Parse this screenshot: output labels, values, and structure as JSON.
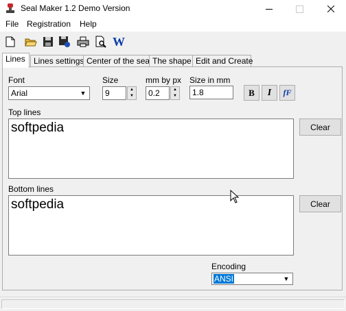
{
  "window": {
    "title": "Seal Maker 1.2 Demo Version",
    "icons": {
      "app": "stamp-icon",
      "minimize": "minimize-icon",
      "maximize": "maximize-icon",
      "close": "close-icon"
    }
  },
  "menu": {
    "file": "File",
    "registration": "Registration",
    "help": "Help"
  },
  "toolbar": {
    "icons": [
      "new-file-icon",
      "open-folder-icon",
      "save-icon",
      "save-as-icon",
      "print-icon",
      "print-preview-icon",
      "word-export-icon"
    ],
    "word_label": "W"
  },
  "tabs": [
    "Lines",
    "Lines settings",
    "Center of the seal",
    "The shape",
    "Edit and Create"
  ],
  "active_tab": "Lines",
  "font": {
    "label": "Font",
    "value": "Arial"
  },
  "size": {
    "label": "Size",
    "value": "9"
  },
  "mm_by_px": {
    "label": "mm by px",
    "value": "0.2"
  },
  "size_mm": {
    "label": "Size in mm",
    "value": "1.8"
  },
  "style_buttons": {
    "bold": "B",
    "italic": "I",
    "font_effect": "fF"
  },
  "top_lines": {
    "label": "Top lines",
    "text": "softpedia",
    "clear_label": "Clear"
  },
  "bottom_lines": {
    "label": "Bottom lines",
    "text": "softpedia",
    "clear_label": "Clear"
  },
  "encoding": {
    "label": "Encoding",
    "value": "ANSI"
  },
  "colors": {
    "accent_blue": "#0a3ba8",
    "selection": "#0078d7"
  }
}
